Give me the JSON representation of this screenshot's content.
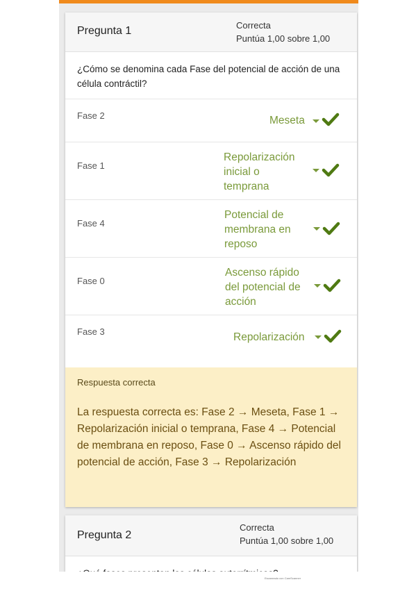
{
  "q1": {
    "title": "Pregunta 1",
    "state": "Correcta",
    "score": "Puntúa 1,00 sobre 1,00",
    "text": "¿Cómo se denomina cada Fase del potencial de acción de una célula contráctil?",
    "rows": [
      {
        "label": "Fase 2",
        "answer": "Meseta"
      },
      {
        "label": "Fase 1",
        "answer": "Repolarización inicial o temprana"
      },
      {
        "label": "Fase 4",
        "answer": "Potencial de membrana en reposo"
      },
      {
        "label": "Fase 0",
        "answer": "Ascenso rápido del potencial de acción"
      },
      {
        "label": "Fase 3",
        "answer": "Repolarización"
      }
    ],
    "feedback_title": "Respuesta correcta",
    "feedback_text": "La respuesta correcta es: Fase 2 → Meseta, Fase 1 → Repolarización inicial o temprana, Fase 4 → Potencial de membrana en reposo, Fase 0 → Ascenso rápido del potencial de acción, Fase 3 → Repolarización"
  },
  "q2": {
    "title": "Pregunta 2",
    "state": "Correcta",
    "score": "Puntúa 1,00 sobre 1,00",
    "text": "¿Qué fases presentan las células autorrítmicas?"
  },
  "colors": {
    "accent": "#f08a1c",
    "correct": "#7a9a3a",
    "feedback_bg": "#fcefc7"
  },
  "icons": {
    "check": "check-icon",
    "caret": "caret-down-icon"
  },
  "footer_note": "Escaneado con CamScanner"
}
